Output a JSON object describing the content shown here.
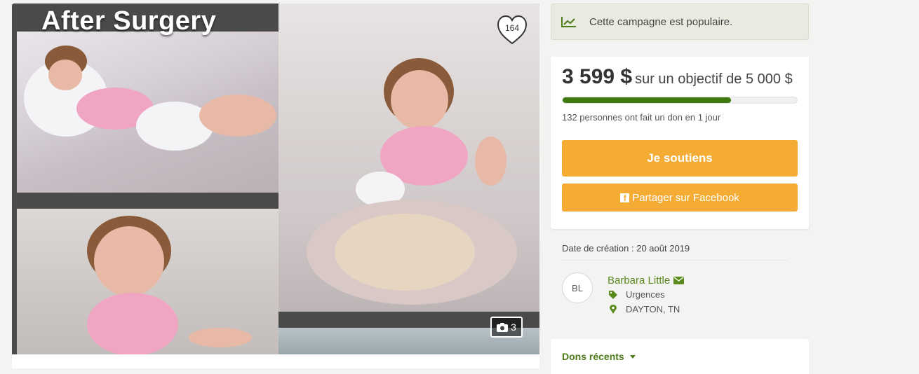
{
  "media": {
    "title_text": "After Surgery",
    "likes": "164",
    "photo_count": "3"
  },
  "popular": {
    "text": "Cette campagne est populaire."
  },
  "funding": {
    "raised": "3 599 $",
    "goal_text": "sur un objectif de 5 000 $",
    "progress_fraction": 0.72,
    "donors_text": "132 personnes ont fait un don en 1 jour",
    "support_label": "Je soutiens",
    "share_label": "Partager sur Facebook"
  },
  "details": {
    "created_label": "Date de création : 20 août 2019",
    "avatar_initials": "BL",
    "owner_name": "Barbara Little",
    "category": "Urgences",
    "location": "DAYTON, TN"
  },
  "recent": {
    "label": "Dons récents"
  },
  "colors": {
    "accent_green": "#3d7a10",
    "button_orange": "#f5ac34",
    "link_green": "#5b8a1e"
  },
  "icons": [
    "heart-icon",
    "camera-icon",
    "trend-chart-icon",
    "facebook-icon",
    "envelope-icon",
    "tag-icon",
    "map-marker-icon",
    "caret-down-icon"
  ]
}
